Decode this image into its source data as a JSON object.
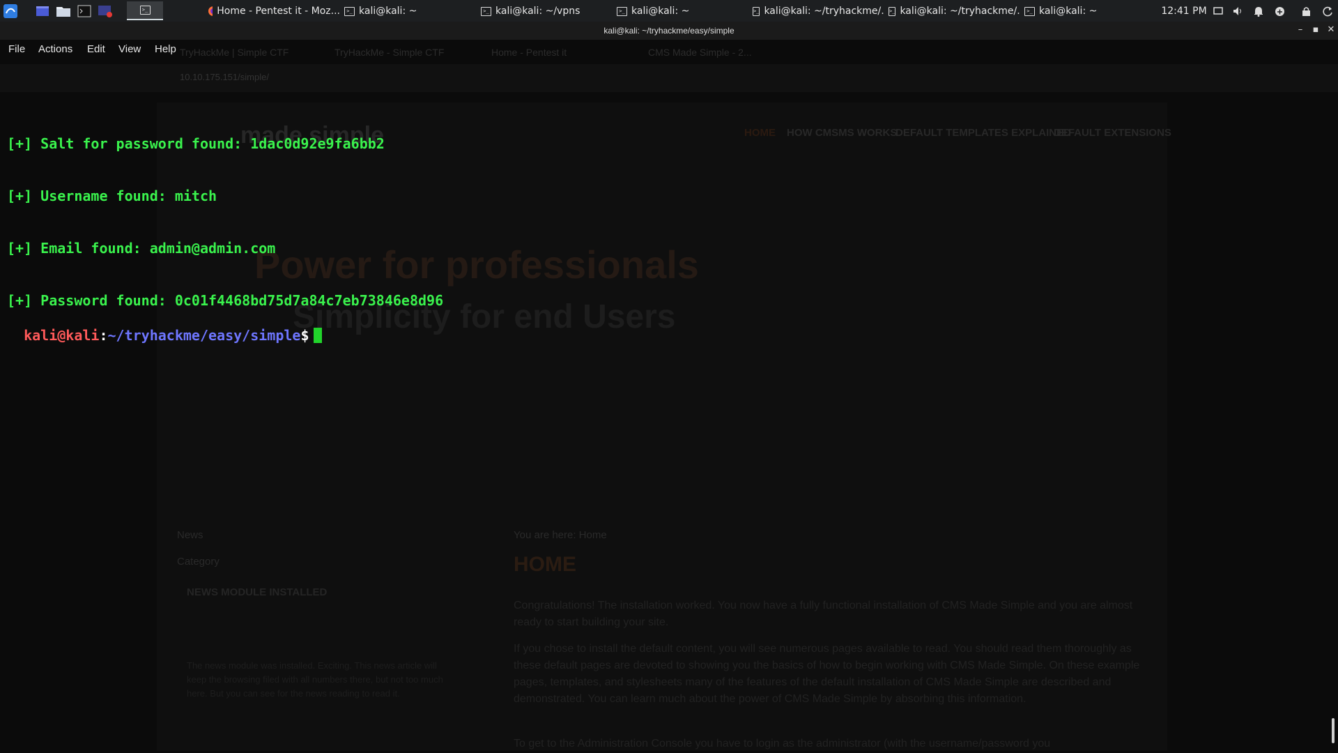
{
  "panel": {
    "tasks": [
      {
        "label": "Home - Pentest it - Moz...",
        "icon": "firefox-icon"
      },
      {
        "label": "kali@kali: ~",
        "icon": "terminal-icon"
      },
      {
        "label": "kali@kali: ~/vpns",
        "icon": "terminal-icon"
      },
      {
        "label": "kali@kali: ~",
        "icon": "terminal-icon"
      },
      {
        "label": "kali@kali: ~/tryhackme/...",
        "icon": "terminal-icon"
      },
      {
        "label": "kali@kali: ~/tryhackme/...",
        "icon": "terminal-icon"
      },
      {
        "label": "kali@kali: ~",
        "icon": "terminal-icon"
      }
    ],
    "clock": "12:41 PM"
  },
  "window": {
    "title": "kali@kali: ~/tryhackme/easy/simple"
  },
  "menu": {
    "file": "File",
    "actions": "Actions",
    "edit": "Edit",
    "view": "View",
    "help": "Help"
  },
  "terminal": {
    "lines": [
      "[+] Salt for password found: 1dac0d92e9fa6bb2",
      "[+] Username found: mitch",
      "[+] Email found: admin@admin.com",
      "[+] Password found: 0c01f4468bd75d7a84c7eb73846e8d96"
    ],
    "prompt_user": "kali@kali",
    "prompt_sep": ":",
    "prompt_path": "~/tryhackme/easy/simple",
    "prompt_symbol": "$"
  },
  "background_page": {
    "tabs": [
      "TryHackMe | Simple CTF",
      "TryHackMe - Simple CTF",
      "Home - Pentest it",
      "CMS Made Simple - 2..."
    ],
    "url": "10.10.175.151/simple/",
    "logo": "made simple",
    "nav": [
      "HOME",
      "HOW CMSMS WORKS",
      "DEFAULT TEMPLATES EXPLAINED",
      "DEFAULT EXTENSIONS"
    ],
    "headline": "Power for professionals",
    "subheadline": "Simplicity for end Users",
    "news_label": "News",
    "category_label": "Category",
    "news_title": "NEWS MODULE INSTALLED",
    "news_text": "The news module was installed. Exciting. This news article will keep the browsing filed with all numbers there, but not too much here. But you can see for the news reading to read it.",
    "breadcrumb": "You are here: Home",
    "page_heading": "HOME",
    "paragraph1": "Congratulations! The installation worked. You now have a fully functional installation of CMS Made Simple and you are almost ready to start building your site.",
    "paragraph2": "If you chose to install the default content, you will see numerous pages available to read. You should read them thoroughly as these default pages are devoted to showing you the basics of how to begin working with CMS Made Simple. On these example pages, templates, and stylesheets many of the features of the default installation of CMS Made Simple are described and demonstrated. You can learn much about the power of CMS Made Simple by absorbing this information.",
    "paragraph3": "To get to the Administration Console you have to login as the administrator (with the username/password you"
  }
}
